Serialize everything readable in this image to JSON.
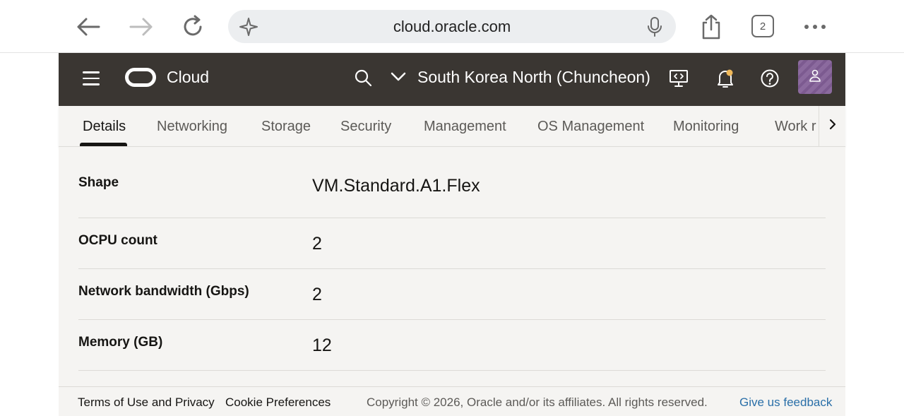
{
  "browser": {
    "url": "cloud.oracle.com",
    "tab_count": "2"
  },
  "header": {
    "brand": "Cloud",
    "region": "South Korea North (Chuncheon)"
  },
  "tabs": [
    {
      "label": "Details",
      "active": true
    },
    {
      "label": "Networking"
    },
    {
      "label": "Storage"
    },
    {
      "label": "Security"
    },
    {
      "label": "Management"
    },
    {
      "label": "OS Management"
    },
    {
      "label": "Monitoring"
    },
    {
      "label": "Work r"
    }
  ],
  "details": [
    {
      "label": "Shape",
      "value": "VM.Standard.A1.Flex"
    },
    {
      "label": "OCPU count",
      "value": "2"
    },
    {
      "label": "Network bandwidth (Gbps)",
      "value": "2"
    },
    {
      "label": "Memory (GB)",
      "value": "12"
    }
  ],
  "footer": {
    "terms": "Terms of Use and Privacy",
    "cookies": "Cookie Preferences",
    "copyright": "Copyright © 2026, Oracle and/or its affiliates. All rights reserved.",
    "feedback": "Give us feedback"
  },
  "colors": {
    "header_bg": "#3a3632",
    "content_bg": "#f5f4f2",
    "link": "#2a6fa8"
  }
}
